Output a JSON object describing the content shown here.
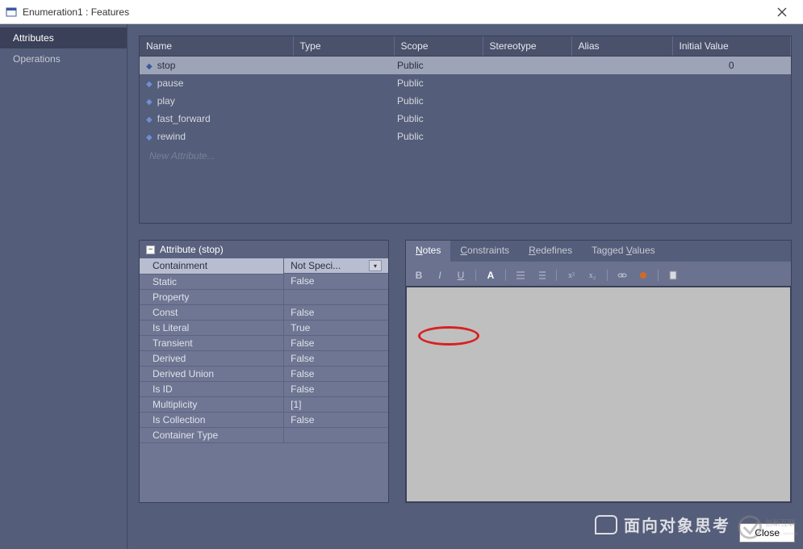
{
  "window": {
    "title": "Enumeration1 : Features"
  },
  "sidebar": {
    "items": [
      {
        "label": "Attributes",
        "active": true
      },
      {
        "label": "Operations",
        "active": false
      }
    ]
  },
  "grid": {
    "headers": [
      "Name",
      "Type",
      "Scope",
      "Stereotype",
      "Alias",
      "Initial Value"
    ],
    "rows": [
      {
        "name": "stop",
        "type": "",
        "scope": "Public",
        "stereotype": "",
        "alias": "",
        "initial": "0",
        "selected": true
      },
      {
        "name": "pause",
        "type": "",
        "scope": "Public",
        "stereotype": "",
        "alias": "",
        "initial": ""
      },
      {
        "name": "play",
        "type": "",
        "scope": "Public",
        "stereotype": "",
        "alias": "",
        "initial": ""
      },
      {
        "name": "fast_forward",
        "type": "",
        "scope": "Public",
        "stereotype": "",
        "alias": "",
        "initial": ""
      },
      {
        "name": "rewind",
        "type": "",
        "scope": "Public",
        "stereotype": "",
        "alias": "",
        "initial": ""
      }
    ],
    "placeholder": "New Attribute..."
  },
  "props": {
    "heading": "Attribute (stop)",
    "rows": [
      {
        "k": "Containment",
        "v": "Not Speci...",
        "selected": true
      },
      {
        "k": "Static",
        "v": "False"
      },
      {
        "k": "Property",
        "v": ""
      },
      {
        "k": "Const",
        "v": "False"
      },
      {
        "k": "Is Literal",
        "v": "True"
      },
      {
        "k": "Transient",
        "v": "False"
      },
      {
        "k": "Derived",
        "v": "False"
      },
      {
        "k": "Derived Union",
        "v": "False"
      },
      {
        "k": "Is ID",
        "v": "False"
      },
      {
        "k": "Multiplicity",
        "v": "[1]"
      },
      {
        "k": "Is Collection",
        "v": "False"
      },
      {
        "k": "Container Type",
        "v": ""
      }
    ]
  },
  "notes": {
    "tabs": [
      {
        "label": "Notes",
        "accel": "N",
        "active": true
      },
      {
        "label": "Constraints",
        "accel": "C"
      },
      {
        "label": "Redefines",
        "accel": "R"
      },
      {
        "label": "Tagged Values",
        "accel": "V"
      }
    ],
    "toolbar": [
      "B",
      "I",
      "U",
      "A",
      "list",
      "x2",
      "x2",
      "clip",
      "inject",
      "doc"
    ]
  },
  "buttons": {
    "close": "Close"
  },
  "watermark": {
    "text": "面向对象思考"
  }
}
